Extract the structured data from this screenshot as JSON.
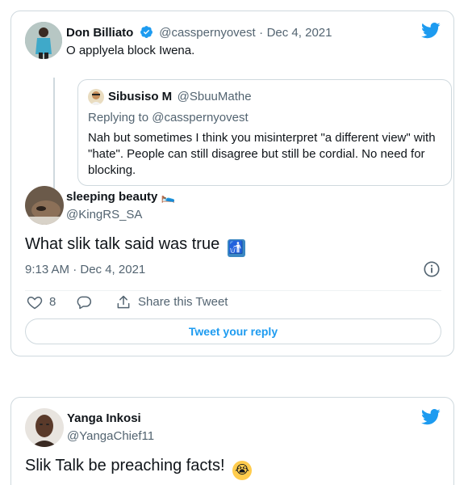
{
  "parent_tweet": {
    "name": "Don Billiato",
    "handle": "@casspernyovest",
    "separator": "·",
    "date": "Dec 4, 2021",
    "text": "O applyela block Iwena."
  },
  "quoted_tweet": {
    "name": "Sibusiso M",
    "handle": "@SbuuMathe",
    "replying_to": "Replying to @casspernyovest",
    "text": "Nah but sometimes I think you misinterpret \"a different view\" with \"hate\". People can still disagree but still be cordial. No need for blocking."
  },
  "main_tweet": {
    "name": "sleeping beauty",
    "name_emoji": "🛌",
    "handle": "@KingRS_SA",
    "text": "What slik talk said was true",
    "text_emoji": "🚮",
    "timestamp": "9:13 AM · Dec 4, 2021",
    "like_count": "8",
    "share_label": "Share this Tweet",
    "reply_button": "Tweet your reply"
  },
  "second_tweet": {
    "name": "Yanga Inkosi",
    "handle": "@YangaChief11",
    "text": "Slik Talk be preaching facts!",
    "text_emoji": "😭"
  },
  "colors": {
    "twitter_blue": "#1d9bf0",
    "border": "#cfd9de",
    "secondary_text": "#536471"
  }
}
